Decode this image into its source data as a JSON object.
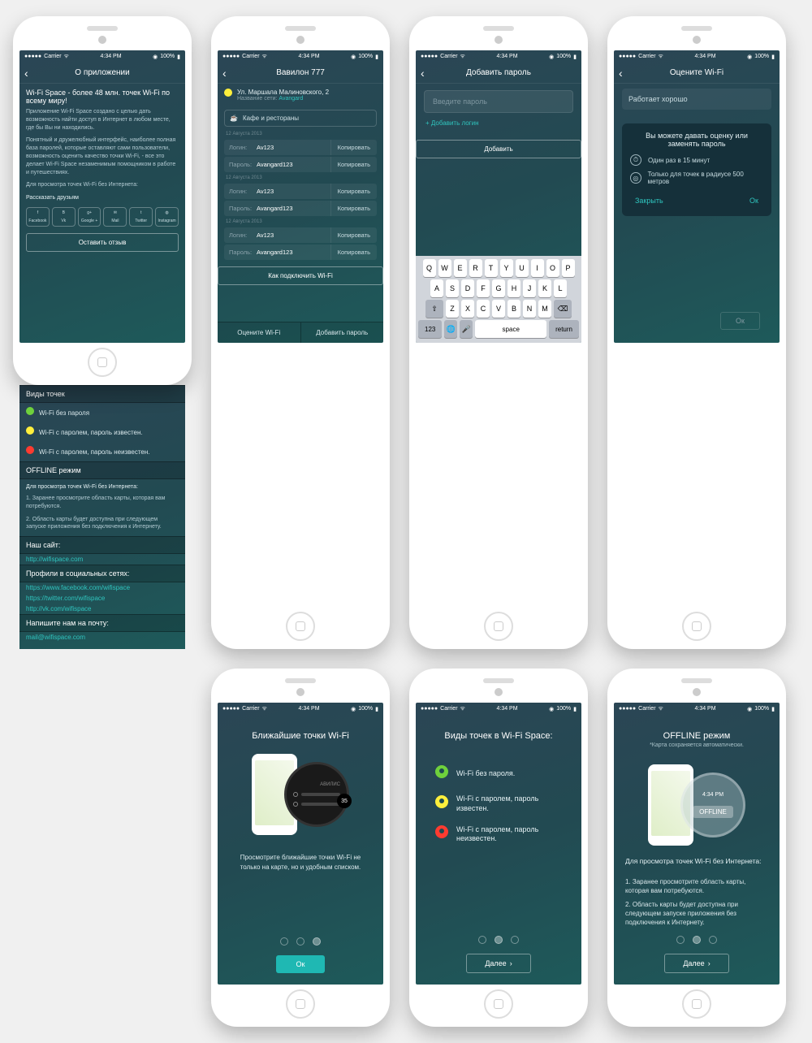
{
  "status": {
    "carrier": "Carrier",
    "time": "4:34 PM",
    "battery": "100%"
  },
  "s1": {
    "title": "О приложении",
    "headline": "Wi-Fi Space - более 48 млн. точек Wi-Fi по всему миру!",
    "p1": "Приложение Wi-Fi Space создано с целью дать возможность найти доступ в Интернет в любом месте, где бы Вы ни находились.",
    "p2": "Понятный и дружелюбный интерфейс, наиболее полная база паролей, которые оставляют сами пользователи, возможность оценить качество точки Wi-Fi, - все это делает Wi-Fi Space незаменимым помощником в работе и путешествиях.",
    "p3": "Для просмотра точек Wi-Fi без Интернета:",
    "share_heading": "Рассказать друзьям",
    "share": [
      "Facebook",
      "Vk",
      "Google +",
      "Mail",
      "Twitter",
      "Instagram"
    ],
    "review_btn": "Оставить отзыв",
    "types_heading": "Виды точек",
    "type_green": "Wi-Fi без пароля",
    "type_yellow": "Wi-Fi с паролем, пароль известен.",
    "type_red": "Wi-Fi с паролем, пароль неизвестен.",
    "offline_heading": "OFFLINE режим",
    "offline_sub": "Для просмотра точек Wi-Fi без Интернета:",
    "offline_1": "1. Заранее просмотрите область карты, которая вам потребуются.",
    "offline_2": "2. Область карты будет доступна при следующем запуске приложения без подключения к Интернету.",
    "site_heading": "Наш сайт:",
    "site_link": "http://wifispace.com",
    "social_heading": "Профили в социальных сетях:",
    "social_fb": "https://www.facebook.com/wifispace",
    "social_tw": "https://twitter.com/wifispace",
    "social_vk": "http://vk.com/wifispace",
    "mail_heading": "Напишите нам на почту:",
    "mail_link": "mail@wifispace.com"
  },
  "s2": {
    "title": "Вавилон  777",
    "address": "Ул. Маршала Малиновского, 2",
    "net_label": "Название сети:",
    "net_name": "Avangard",
    "category": "Кафе и рестораны",
    "date": "12 Августа 2013",
    "login_lbl": "Логин:",
    "pass_lbl": "Пароль:",
    "login": "Av123",
    "pass": "Avangard123",
    "copy": "Копировать",
    "connect_btn": "Как подключить Wi-Fi",
    "tab_rate": "Оцените Wi-Fi",
    "tab_add": "Добавить пароль"
  },
  "s3": {
    "title": "Добавить пароль",
    "placeholder": "Введите пароль",
    "add_login": "+ Добавить логин",
    "add_btn": "Добавить",
    "kb_r1": [
      "Q",
      "W",
      "E",
      "R",
      "T",
      "Y",
      "U",
      "I",
      "O",
      "P"
    ],
    "kb_r2": [
      "A",
      "S",
      "D",
      "F",
      "G",
      "H",
      "J",
      "K",
      "L"
    ],
    "kb_r3": [
      "Z",
      "X",
      "C",
      "V",
      "B",
      "N",
      "M"
    ],
    "kb_123": "123",
    "kb_space": "space",
    "kb_return": "return"
  },
  "s4": {
    "title": "Оцените Wi-Fi",
    "status_text": "Работает хорошо",
    "modal_title": "Вы можете давать оценку или заменять пароль",
    "item1": "Один раз в 15 минут",
    "item2": "Только для точек в радиусе 500 метров",
    "close": "Закрыть",
    "ok": "Ок",
    "ok_ghost": "Ок"
  },
  "s5": {
    "title": "Ближайшие точки Wi-Fi",
    "body": "Просмотрите ближайшие точки Wi-Fi не только на карте, но и удобным списком.",
    "count": "35",
    "ok": "Ок"
  },
  "s6": {
    "title": "Виды точек в Wi-Fi Space:",
    "green": "Wi-Fi без пароля.",
    "yellow": "Wi-Fi с паролем, пароль известен.",
    "red": "Wi-Fi с паролем, пароль неизвестен.",
    "next": "Далее"
  },
  "s7": {
    "title": "OFFLINE режим",
    "subtitle": "*Карта сохраняется автоматически.",
    "time": "4:34 PM",
    "badge": "OFFLINE",
    "heading": "Для просмотра точек Wi-Fi без Интернета:",
    "p1": "1. Заранее просмотрите область карты, которая вам потребуются.",
    "p2": "2. Область карты будет доступна при следующем запуске приложения без подключения к Интернету.",
    "next": "Далее"
  }
}
